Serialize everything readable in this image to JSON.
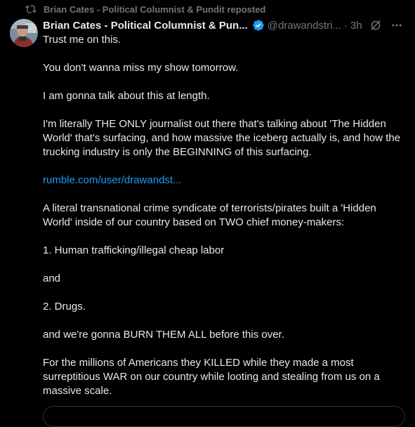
{
  "repost": {
    "label": "Brian Cates - Political Columnist & Pundit reposted",
    "icon": "repost-icon"
  },
  "author": {
    "display_name": "Brian Cates - Political Columnist & Pun...",
    "handle": "@drawandstri...",
    "separator": "·",
    "time": "3h",
    "verified": true,
    "verified_color": "#1d9bf0"
  },
  "post": {
    "paragraphs": [
      "Trust me on this.",
      "You don't wanna miss my show tomorrow.",
      "I am gonna talk about this at length.",
      "I'm literally THE ONLY journalist out there that's talking about 'The Hidden World' that's surfacing, and how massive the iceberg actually is, and how the trucking industry is only the BEGINNING of this surfacing.",
      "A literal transnational crime syndicate of terrorists/pirates built a 'Hidden World' inside of our country based on TWO chief money-makers:",
      "1. Human trafficking/illegal cheap labor",
      "and",
      "2. Drugs.",
      "and we're gonna BURN THEM ALL before this over.",
      "For the millions of Americans they KILLED while they made a most surreptitious WAR on our country while looting and stealing from us on a massive scale."
    ],
    "link_text": "rumble.com/user/drawandst..."
  },
  "colors": {
    "background": "#000000",
    "text": "#e7e9ea",
    "muted": "#71767b",
    "link": "#1d9bf0",
    "border": "#2f3336"
  }
}
